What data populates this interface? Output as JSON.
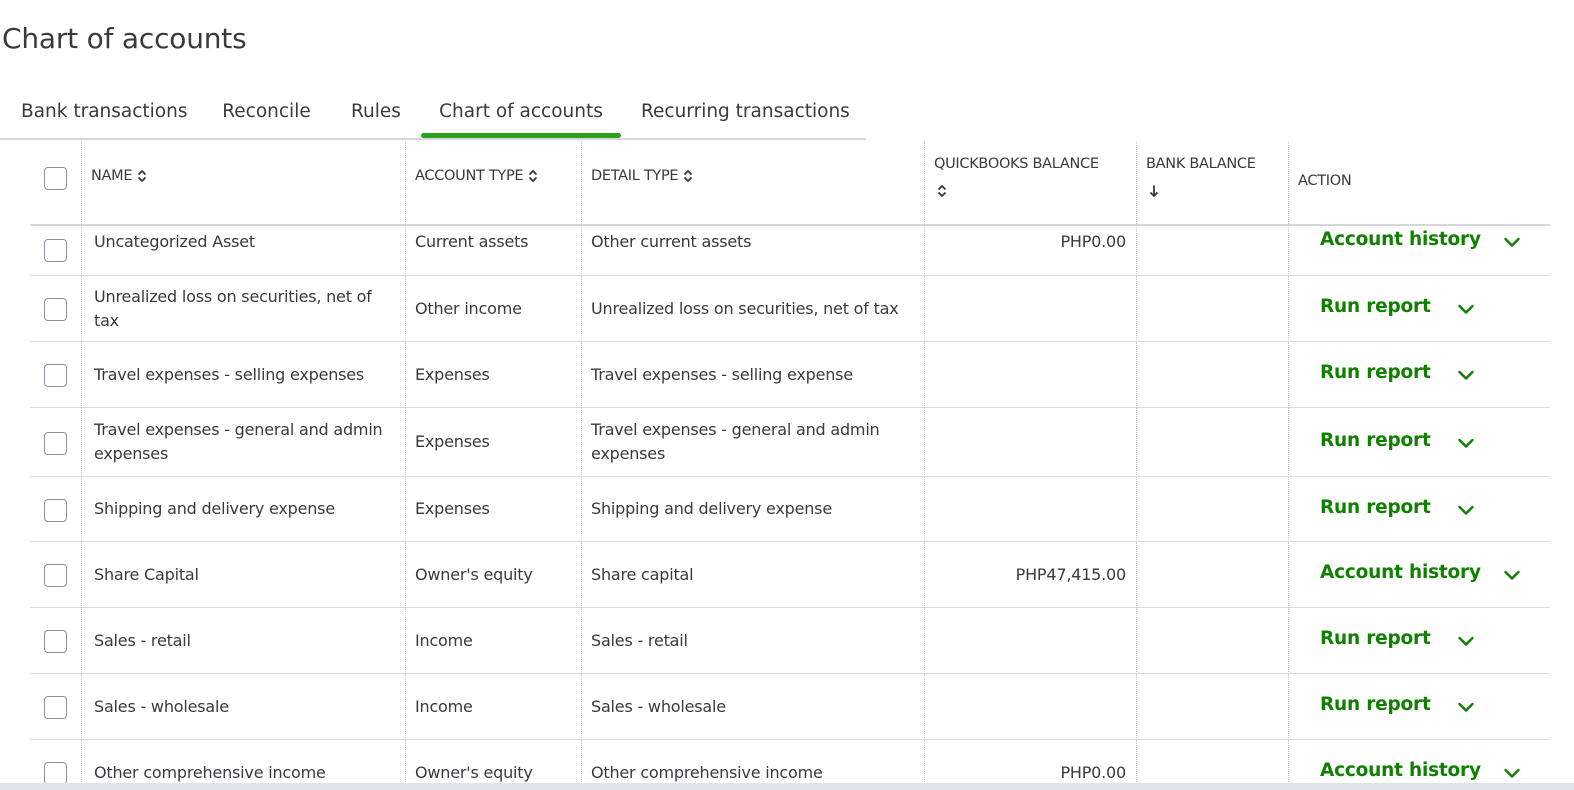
{
  "page": {
    "title": "Chart of accounts"
  },
  "tabs": [
    {
      "label": "Bank transactions",
      "active": false
    },
    {
      "label": "Reconcile",
      "active": false
    },
    {
      "label": "Rules",
      "active": false
    },
    {
      "label": "Chart of accounts",
      "active": true
    },
    {
      "label": "Recurring transactions",
      "active": false
    }
  ],
  "table": {
    "columns": {
      "name": "NAME",
      "account_type": "ACCOUNT TYPE",
      "detail_type": "DETAIL TYPE",
      "quickbooks_balance": "QUICKBOOKS BALANCE",
      "bank_balance": "BANK BALANCE",
      "action": "ACTION"
    },
    "rows": [
      {
        "name": "Uncategorized Asset",
        "account_type": "Current assets",
        "detail_type": "Other current assets",
        "qb_balance": "PHP0.00",
        "bank_balance": "",
        "action": "Account history"
      },
      {
        "name": "Unrealized loss on securities, net of tax",
        "account_type": "Other income",
        "detail_type": "Unrealized loss on securities, net of tax",
        "qb_balance": "",
        "bank_balance": "",
        "action": "Run report"
      },
      {
        "name": "Travel expenses - selling expenses",
        "account_type": "Expenses",
        "detail_type": "Travel expenses - selling expense",
        "qb_balance": "",
        "bank_balance": "",
        "action": "Run report"
      },
      {
        "name": "Travel expenses - general and admin expenses",
        "account_type": "Expenses",
        "detail_type": "Travel expenses - general and admin expenses",
        "qb_balance": "",
        "bank_balance": "",
        "action": "Run report"
      },
      {
        "name": "Shipping and delivery expense",
        "account_type": "Expenses",
        "detail_type": "Shipping and delivery expense",
        "qb_balance": "",
        "bank_balance": "",
        "action": "Run report"
      },
      {
        "name": "Share Capital",
        "account_type": "Owner's equity",
        "detail_type": "Share capital",
        "qb_balance": "PHP47,415.00",
        "bank_balance": "",
        "action": "Account history"
      },
      {
        "name": "Sales - retail",
        "account_type": "Income",
        "detail_type": "Sales - retail",
        "qb_balance": "",
        "bank_balance": "",
        "action": "Run report"
      },
      {
        "name": "Sales - wholesale",
        "account_type": "Income",
        "detail_type": "Sales - wholesale",
        "qb_balance": "",
        "bank_balance": "",
        "action": "Run report"
      },
      {
        "name": "Other comprehensive income",
        "account_type": "Owner's equity",
        "detail_type": "Other comprehensive income",
        "qb_balance": "PHP0.00",
        "bank_balance": "",
        "action": "Account history"
      }
    ]
  },
  "icons": {
    "sort": "sort-updown-icon",
    "sort_active": "arrow-down-icon",
    "row_menu": "chevron-down-icon"
  },
  "colors": {
    "accent_green": "#2ca01c",
    "link_green": "#108000",
    "text": "#393a3d"
  }
}
